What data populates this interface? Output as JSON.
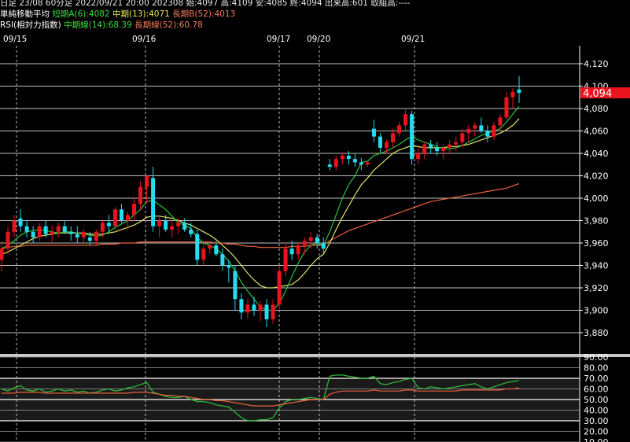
{
  "header": {
    "line1": "日足 23/08 60分足 2022/09/21 20:00 202308 始:4097 高:4109 安:4085 終:4094 出来高:601 取組高:----",
    "ma": {
      "label": "単純移動平均",
      "short": "短期A(6):4082",
      "mid": "中期(13):4071",
      "long": "長期B(52):4013"
    },
    "rsi": {
      "label": "RSI(相対力指数)",
      "mid": "中期線(14):68.39",
      "long": "長期線(52):60.78"
    }
  },
  "colors": {
    "up": "#e8141e",
    "down": "#26dcf0",
    "ma_short": "#2fbf3a",
    "ma_mid": "#e3e36a",
    "ma_long": "#e8623c",
    "price_tag": "#e8141e"
  },
  "chart_data": [
    {
      "type": "candlestick",
      "x_labels": [
        "09/15",
        "09/16",
        "09/17",
        "09/20",
        "09/21"
      ],
      "ylim": [
        3860,
        4130
      ],
      "yticks": [
        3880,
        3900,
        3920,
        3940,
        3960,
        3980,
        4000,
        4020,
        4040,
        4060,
        4080,
        4100,
        4120
      ],
      "last_price": "4,094",
      "candles": [
        [
          3945,
          3960,
          3935,
          3955
        ],
        [
          3955,
          3975,
          3950,
          3970
        ],
        [
          3970,
          3985,
          3965,
          3980
        ],
        [
          3982,
          3990,
          3970,
          3975
        ],
        [
          3975,
          3980,
          3965,
          3970
        ],
        [
          3970,
          3975,
          3960,
          3965
        ],
        [
          3965,
          3978,
          3962,
          3975
        ],
        [
          3975,
          3980,
          3965,
          3968
        ],
        [
          3968,
          3975,
          3960,
          3970
        ],
        [
          3970,
          3978,
          3965,
          3975
        ],
        [
          3975,
          3980,
          3968,
          3970
        ],
        [
          3970,
          3975,
          3962,
          3968
        ],
        [
          3968,
          3975,
          3960,
          3965
        ],
        [
          3965,
          3972,
          3960,
          3970
        ],
        [
          3965,
          3970,
          3958,
          3962
        ],
        [
          3962,
          3972,
          3958,
          3970
        ],
        [
          3970,
          3980,
          3965,
          3978
        ],
        [
          3978,
          3985,
          3970,
          3975
        ],
        [
          3975,
          3992,
          3972,
          3990
        ],
        [
          3990,
          3995,
          3978,
          3980
        ],
        [
          3980,
          3988,
          3972,
          3985
        ],
        [
          3985,
          4000,
          3980,
          3995
        ],
        [
          3995,
          4015,
          3990,
          4010
        ],
        [
          4010,
          4020,
          3995,
          4020
        ],
        [
          4018,
          4028,
          3970,
          3975
        ],
        [
          3975,
          3985,
          3965,
          3980
        ],
        [
          3980,
          3985,
          3970,
          3972
        ],
        [
          3972,
          3980,
          3965,
          3975
        ],
        [
          3975,
          3982,
          3968,
          3978
        ],
        [
          3978,
          3982,
          3970,
          3972
        ],
        [
          3972,
          3978,
          3965,
          3968
        ],
        [
          3968,
          3972,
          3940,
          3945
        ],
        [
          3945,
          3960,
          3940,
          3955
        ],
        [
          3955,
          3962,
          3950,
          3958
        ],
        [
          3958,
          3962,
          3948,
          3950
        ],
        [
          3950,
          3955,
          3935,
          3940
        ],
        [
          3940,
          3945,
          3925,
          3938
        ],
        [
          3935,
          3940,
          3900,
          3910
        ],
        [
          3910,
          3915,
          3892,
          3898
        ],
        [
          3898,
          3910,
          3893,
          3905
        ],
        [
          3905,
          3912,
          3895,
          3900
        ],
        [
          3900,
          3908,
          3890,
          3905
        ],
        [
          3905,
          3910,
          3885,
          3892
        ],
        [
          3892,
          3910,
          3888,
          3905
        ],
        [
          3905,
          3940,
          3900,
          3935
        ],
        [
          3935,
          3960,
          3930,
          3955
        ],
        [
          3955,
          3962,
          3945,
          3950
        ],
        [
          3950,
          3960,
          3945,
          3958
        ],
        [
          3958,
          3965,
          3950,
          3962
        ],
        [
          3962,
          3970,
          3955,
          3965
        ],
        [
          3965,
          3968,
          3955,
          3960
        ],
        [
          3960,
          3965,
          3950,
          3955
        ],
        [
          4030,
          4035,
          4025,
          4028
        ],
        [
          4028,
          4038,
          4025,
          4035
        ],
        [
          4035,
          4040,
          4030,
          4038
        ],
        [
          4038,
          4042,
          4030,
          4035
        ],
        [
          4035,
          4040,
          4028,
          4032
        ],
        [
          4032,
          4036,
          4025,
          4030
        ],
        [
          4030,
          4034,
          4028,
          4032
        ],
        [
          4062,
          4070,
          4050,
          4055
        ],
        [
          4055,
          4058,
          4040,
          4045
        ],
        [
          4045,
          4052,
          4040,
          4050
        ],
        [
          4050,
          4062,
          4045,
          4058
        ],
        [
          4058,
          4068,
          4055,
          4065
        ],
        [
          4065,
          4080,
          4060,
          4075
        ],
        [
          4075,
          4078,
          4030,
          4035
        ],
        [
          4035,
          4045,
          4030,
          4040
        ],
        [
          4040,
          4050,
          4035,
          4048
        ],
        [
          4048,
          4052,
          4040,
          4045
        ],
        [
          4045,
          4050,
          4038,
          4042
        ],
        [
          4042,
          4048,
          4035,
          4045
        ],
        [
          4045,
          4052,
          4040,
          4048
        ],
        [
          4048,
          4055,
          4042,
          4050
        ],
        [
          4050,
          4062,
          4045,
          4058
        ],
        [
          4058,
          4065,
          4050,
          4062
        ],
        [
          4062,
          4068,
          4055,
          4065
        ],
        [
          4065,
          4072,
          4058,
          4060
        ],
        [
          4060,
          4065,
          4050,
          4055
        ],
        [
          4055,
          4068,
          4052,
          4065
        ],
        [
          4065,
          4075,
          4060,
          4072
        ],
        [
          4072,
          4095,
          4070,
          4090
        ],
        [
          4090,
          4098,
          4080,
          4095
        ],
        [
          4097,
          4109,
          4085,
          4094
        ]
      ],
      "ma_short": [
        3955,
        3958,
        3962,
        3967,
        3970,
        3971,
        3972,
        3971,
        3970,
        3969,
        3970,
        3970,
        3969,
        3968,
        3967,
        3966,
        3967,
        3970,
        3974,
        3977,
        3980,
        3985,
        3990,
        3997,
        3998,
        3994,
        3990,
        3984,
        3978,
        3976,
        3973,
        3965,
        3960,
        3958,
        3955,
        3950,
        3944,
        3935,
        3925,
        3917,
        3910,
        3903,
        3900,
        3900,
        3906,
        3917,
        3930,
        3942,
        3952,
        3958,
        3960,
        3958,
        3970,
        3985,
        4000,
        4012,
        4020,
        4032,
        4033,
        4038,
        4040,
        4042,
        4045,
        4048,
        4052,
        4055,
        4052,
        4050,
        4048,
        4046,
        4044,
        4044,
        4045,
        4047,
        4050,
        4053,
        4056,
        4058,
        4060,
        4062,
        4068,
        4075,
        4082
      ],
      "ma_mid": [
        3950,
        3952,
        3955,
        3958,
        3961,
        3964,
        3966,
        3967,
        3968,
        3969,
        3969,
        3969,
        3969,
        3969,
        3968,
        3968,
        3968,
        3969,
        3970,
        3972,
        3974,
        3976,
        3979,
        3983,
        3984,
        3984,
        3983,
        3982,
        3980,
        3978,
        3976,
        3973,
        3970,
        3967,
        3963,
        3958,
        3953,
        3947,
        3940,
        3933,
        3927,
        3922,
        3920,
        3920,
        3921,
        3922,
        3923,
        3927,
        3933,
        3940,
        3946,
        3950,
        3960,
        3972,
        3983,
        3993,
        4003,
        4012,
        4018,
        4025,
        4030,
        4035,
        4040,
        4043,
        4045,
        4047,
        4046,
        4045,
        4045,
        4045,
        4045,
        4046,
        4046,
        4047,
        4048,
        4050,
        4052,
        4054,
        4056,
        4058,
        4061,
        4065,
        4071
      ],
      "ma_long": [
        3955,
        3956,
        3957,
        3957,
        3958,
        3958,
        3958,
        3958,
        3958,
        3958,
        3958,
        3958,
        3958,
        3958,
        3958,
        3958,
        3959,
        3959,
        3959,
        3960,
        3960,
        3960,
        3961,
        3961,
        3961,
        3961,
        3961,
        3961,
        3961,
        3961,
        3961,
        3961,
        3961,
        3961,
        3960,
        3960,
        3959,
        3959,
        3958,
        3957,
        3957,
        3956,
        3956,
        3956,
        3956,
        3956,
        3957,
        3957,
        3957,
        3958,
        3958,
        3958,
        3962,
        3965,
        3968,
        3971,
        3973,
        3975,
        3977,
        3979,
        3981,
        3983,
        3985,
        3987,
        3989,
        3991,
        3993,
        3995,
        3997,
        3998,
        3999,
        4000,
        4001,
        4002,
        4003,
        4004,
        4005,
        4006,
        4007,
        4008,
        4009,
        4011,
        4013
      ]
    },
    {
      "type": "line",
      "title": "RSI",
      "ylim": [
        10,
        90
      ],
      "yticks": [
        "90.00",
        "80.00",
        "70.00",
        "60.00",
        "50.00",
        "40.00",
        "30.00",
        "20.00",
        "10.00"
      ],
      "series": [
        {
          "name": "中期線(14)",
          "values": [
            60,
            58,
            61,
            63,
            59,
            58,
            60,
            57,
            58,
            60,
            58,
            59,
            57,
            58,
            56,
            57,
            59,
            60,
            58,
            59,
            61,
            62,
            64,
            66,
            57,
            55,
            53,
            52,
            52,
            53,
            50,
            48,
            48,
            47,
            45,
            44,
            43,
            38,
            33,
            30,
            30,
            31,
            31,
            33,
            42,
            48,
            50,
            50,
            51,
            52,
            51,
            50,
            72,
            73,
            73,
            72,
            71,
            70,
            70,
            72,
            65,
            64,
            66,
            67,
            69,
            70,
            61,
            60,
            62,
            61,
            60,
            61,
            62,
            63,
            64,
            65,
            62,
            60,
            62,
            64,
            66,
            67,
            68
          ]
        },
        {
          "name": "長期線(52)",
          "values": [
            56,
            56,
            56,
            57,
            57,
            57,
            57,
            56,
            56,
            56,
            56,
            56,
            56,
            56,
            56,
            56,
            56,
            56,
            56,
            56,
            56,
            57,
            57,
            57,
            56,
            55,
            54,
            54,
            53,
            53,
            52,
            51,
            50,
            50,
            49,
            49,
            48,
            47,
            46,
            45,
            44,
            44,
            44,
            44,
            45,
            46,
            47,
            48,
            49,
            50,
            50,
            50,
            55,
            57,
            58,
            58,
            58,
            58,
            58,
            59,
            58,
            58,
            58,
            58,
            59,
            59,
            58,
            58,
            58,
            58,
            58,
            58,
            58,
            59,
            59,
            59,
            59,
            59,
            59,
            59,
            60,
            60,
            61
          ]
        }
      ]
    }
  ]
}
